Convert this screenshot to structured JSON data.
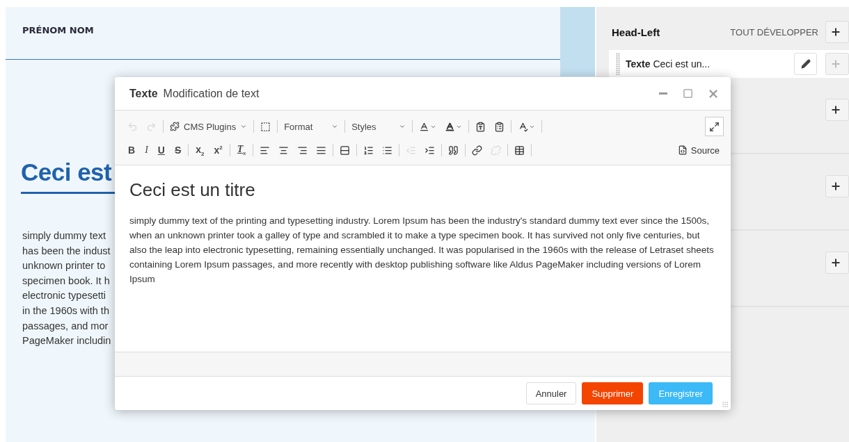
{
  "page": {
    "author": "PRÉNOM NOM",
    "heading": "Ceci est",
    "lines": [
      "simply dummy text",
      "has been the indust",
      "unknown printer to",
      "specimen book. It h",
      "electronic typesetti",
      "in the 1960s with th",
      "passages, and mor",
      "PageMaker includin"
    ]
  },
  "structure": {
    "title": "Head-Left",
    "expand_all": "TOUT DÉVELOPPER",
    "plugin": {
      "type": "Texte",
      "text": "Ceci est un..."
    }
  },
  "dialog": {
    "type": "Texte",
    "title": "Modification de text",
    "toolbar": [
      [
        {
          "kind": "undo",
          "disabled": true
        },
        {
          "kind": "redo",
          "disabled": true
        },
        {
          "kind": "separator"
        },
        {
          "kind": "plugins",
          "label": "CMS Plugins"
        },
        {
          "kind": "separator"
        },
        {
          "kind": "blocks",
          "disabled": false
        },
        {
          "kind": "separator"
        },
        {
          "kind": "dropdown",
          "label": "Format"
        },
        {
          "kind": "separator"
        },
        {
          "kind": "dropdown",
          "label": "Styles"
        },
        {
          "kind": "separator"
        },
        {
          "kind": "textcolor",
          "disabled": false
        },
        {
          "kind": "bgcolor",
          "disabled": false
        },
        {
          "kind": "separator"
        },
        {
          "kind": "pastetext",
          "disabled": false
        },
        {
          "kind": "pasteword",
          "disabled": false
        },
        {
          "kind": "separator"
        },
        {
          "kind": "spellcheck",
          "disabled": false
        },
        {
          "kind": "separator"
        },
        {
          "kind": "spacer"
        },
        {
          "kind": "maximize",
          "disabled": false
        }
      ],
      [
        {
          "kind": "bold",
          "label": "B"
        },
        {
          "kind": "italic",
          "label": "I"
        },
        {
          "kind": "underline",
          "label": "U"
        },
        {
          "kind": "strike",
          "label": "S"
        },
        {
          "kind": "separator"
        },
        {
          "kind": "subscript",
          "label": "x$_{2}$"
        },
        {
          "kind": "superscript",
          "label": "x$^{2}$"
        },
        {
          "kind": "separator"
        },
        {
          "kind": "clearformat",
          "label": "T$_{x}$"
        },
        {
          "kind": "separator"
        },
        {
          "kind": "alignleft",
          "disabled": false
        },
        {
          "kind": "aligncenter",
          "disabled": false
        },
        {
          "kind": "alignright",
          "disabled": false
        },
        {
          "kind": "justify",
          "disabled": false
        },
        {
          "kind": "separator"
        },
        {
          "kind": "rule",
          "disabled": false
        },
        {
          "kind": "separator"
        },
        {
          "kind": "numbered",
          "disabled": false
        },
        {
          "kind": "bulleted",
          "disabled": false
        },
        {
          "kind": "separator"
        },
        {
          "kind": "outdent",
          "disabled": true
        },
        {
          "kind": "indent",
          "disabled": false
        },
        {
          "kind": "separator"
        },
        {
          "kind": "quote",
          "disabled": false
        },
        {
          "kind": "separator"
        },
        {
          "kind": "link",
          "disabled": false
        },
        {
          "kind": "unlink",
          "disabled": true
        },
        {
          "kind": "separator"
        },
        {
          "kind": "table",
          "disabled": false
        },
        {
          "kind": "separator"
        },
        {
          "kind": "spacer"
        },
        {
          "kind": "source",
          "label": "Source"
        }
      ]
    ],
    "content": {
      "heading": "Ceci est un titre",
      "paragraph": "simply dummy text of the printing and typesetting industry. Lorem Ipsum has been the industry's standard dummy text ever since the 1500s, when an unknown printer took a galley of type and scrambled it to make a type specimen book. It has survived not only five centuries, but also the leap into electronic typesetting, remaining essentially unchanged. It was popularised in the 1960s with the release of Letraset sheets containing Lorem Ipsum passages, and more recently with desktop publishing software like Aldus PageMaker including versions of Lorem Ipsum"
    },
    "buttons": [
      {
        "kind": "cancel",
        "label": "Annuler"
      },
      {
        "kind": "delete",
        "label": "Supprimer"
      },
      {
        "kind": "save",
        "label": "Enregistrer"
      }
    ]
  }
}
